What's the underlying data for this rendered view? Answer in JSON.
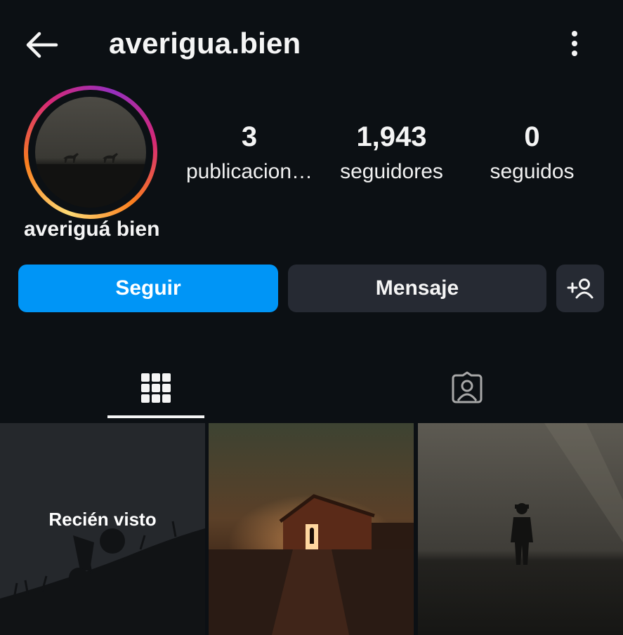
{
  "header": {
    "username": "averigua.bien",
    "back_icon": "arrow-left-icon",
    "more_icon": "more-vertical-icon"
  },
  "profile": {
    "display_name": "averiguá bien",
    "avatar_description": "horses-in-field-avatar",
    "stats": {
      "posts": {
        "value": "3",
        "label": "publicacion…"
      },
      "followers": {
        "value": "1,943",
        "label": "seguidores"
      },
      "following": {
        "value": "0",
        "label": "seguidos"
      }
    }
  },
  "actions": {
    "follow_label": "Seguir",
    "message_label": "Mensaje",
    "suggest_icon": "add-user-icon"
  },
  "tabs": [
    {
      "icon": "grid-icon",
      "selected": true
    },
    {
      "icon": "tagged-person-icon",
      "selected": false
    }
  ],
  "grid": {
    "tiles": [
      {
        "overlay_label": "Recién visto"
      },
      {
        "overlay_label": ""
      },
      {
        "overlay_label": ""
      }
    ]
  },
  "colors": {
    "background": "#0c1014",
    "follow_button": "#0095f6",
    "secondary_button": "#262a33"
  }
}
